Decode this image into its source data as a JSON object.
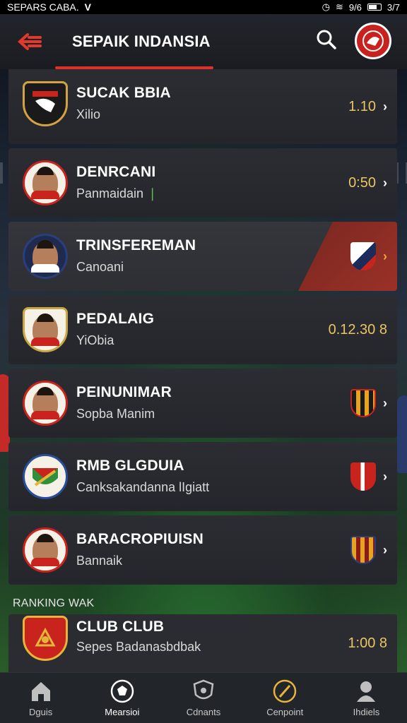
{
  "status_bar": {
    "left_text": "SEPARS CABA.",
    "right_text": "3/7",
    "signal_text": "9/6"
  },
  "header": {
    "title": "SEPAIK INDANSIA",
    "back_icon": "back-arrow-icon",
    "search_icon": "search-icon",
    "accent": "#e0302a"
  },
  "items": [
    {
      "name": "SUCAK BBIA",
      "sub": "Xilio",
      "value": "1.10"
    },
    {
      "name": "DENRCANI",
      "sub": "Panmaidain",
      "value": "0:50"
    },
    {
      "name": "TRINSFEREMAN",
      "sub": "Canoani",
      "value": ""
    },
    {
      "name": "PEDALAIG",
      "sub": "YiObia",
      "value": "0.12.30 8"
    },
    {
      "name": "PEINUNIMAR",
      "sub": "Sopba Manim",
      "value": ""
    },
    {
      "name": "RMB GLGDUIA",
      "sub": "Canksakandanna lIgiatt",
      "value": ""
    },
    {
      "name": "BARACROPIUISN",
      "sub": "Bannaik",
      "value": ""
    }
  ],
  "section": {
    "label": "RANKING WAK"
  },
  "last_item": {
    "name": "CLUB CLUB",
    "sub": "Sepes Badanasbdbak",
    "value": "1:00 8"
  },
  "nav": [
    {
      "label": "Dguis",
      "icon": "home-icon"
    },
    {
      "label": "Mearsioi",
      "icon": "soccer-ball-icon"
    },
    {
      "label": "Cdnants",
      "icon": "shield-icon"
    },
    {
      "label": "Cenpoint",
      "icon": "compass-icon"
    },
    {
      "label": "Ihdiels",
      "icon": "profile-icon"
    }
  ]
}
